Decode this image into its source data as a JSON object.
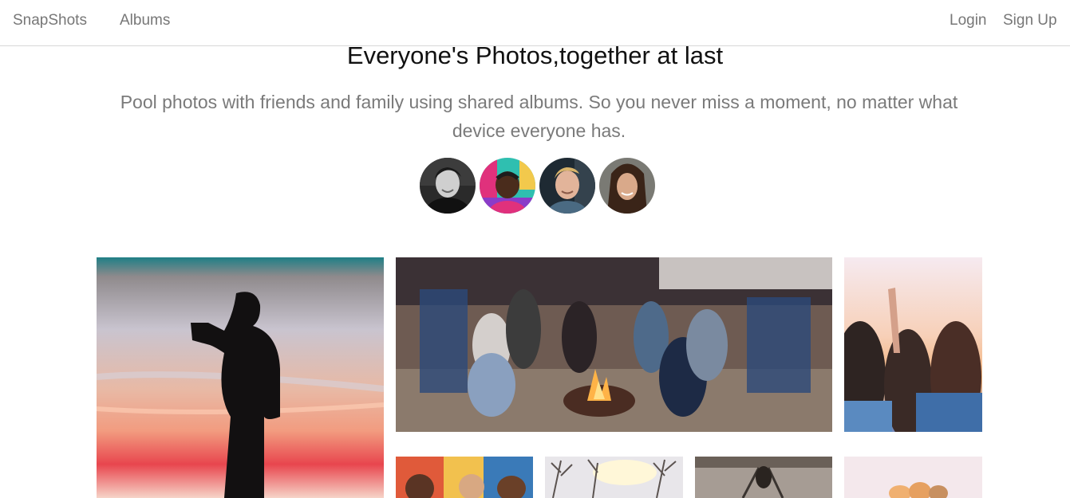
{
  "nav": {
    "brand": "SnapShots",
    "albums": "Albums",
    "login": "Login",
    "signup": "Sign Up"
  },
  "hero": {
    "title": "Everyone's Photos,together at last",
    "subtitle": "Pool photos with friends and family using shared albums. So you never miss a moment, no matter what device everyone has."
  },
  "colors": {
    "nav_text": "#777777",
    "subtitle_text": "#7a7a7a",
    "divider": "#d8d8d8"
  }
}
